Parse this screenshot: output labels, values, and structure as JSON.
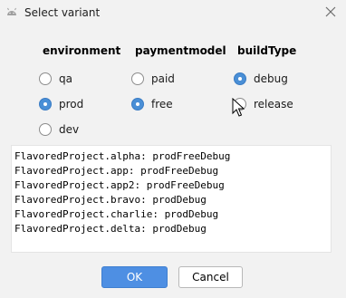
{
  "window": {
    "title": "Select variant",
    "icon": "android-icon",
    "close_icon": "close-icon"
  },
  "columns": [
    {
      "header": "environment",
      "options": [
        {
          "label": "qa",
          "selected": false
        },
        {
          "label": "prod",
          "selected": true
        },
        {
          "label": "dev",
          "selected": false
        }
      ]
    },
    {
      "header": "paymentmodel",
      "options": [
        {
          "label": "paid",
          "selected": false
        },
        {
          "label": "free",
          "selected": true
        }
      ]
    },
    {
      "header": "buildType",
      "options": [
        {
          "label": "debug",
          "selected": true
        },
        {
          "label": "release",
          "selected": false
        }
      ]
    }
  ],
  "output_lines": [
    "FlavoredProject.alpha: prodFreeDebug",
    "FlavoredProject.app: prodFreeDebug",
    "FlavoredProject.app2: prodFreeDebug",
    "FlavoredProject.bravo: prodDebug",
    "FlavoredProject.charlie: prodDebug",
    "FlavoredProject.delta: prodDebug"
  ],
  "buttons": {
    "ok": "OK",
    "cancel": "Cancel"
  },
  "colors": {
    "accent": "#4e8fe3",
    "background": "#f2f2f2",
    "android": "#9e9e9e"
  }
}
